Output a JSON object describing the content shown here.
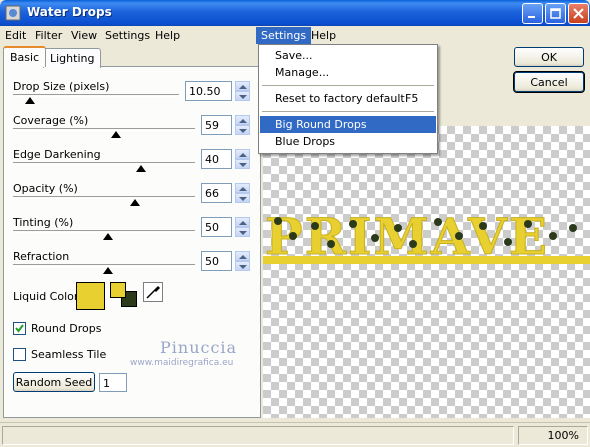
{
  "window": {
    "title": "Water Drops"
  },
  "menubar": {
    "items": [
      "Edit",
      "Filter",
      "View",
      "Settings",
      "Help",
      "Settings",
      "Help"
    ]
  },
  "tabs": [
    "Basic",
    "Lighting"
  ],
  "params": [
    {
      "label": "Drop Size (pixels)",
      "value": "10.50"
    },
    {
      "label": "Coverage (%)",
      "value": "59"
    },
    {
      "label": "Edge Darkening",
      "value": "40"
    },
    {
      "label": "Opacity (%)",
      "value": "66"
    },
    {
      "label": "Tinting (%)",
      "value": "50"
    },
    {
      "label": "Refraction",
      "value": "50"
    }
  ],
  "liquid_color": {
    "label": "Liquid Color",
    "color": "#e8d030",
    "fg": "#e8d030",
    "bg": "#2a3a1a"
  },
  "checkboxes": [
    {
      "label": "Round Drops",
      "checked": true
    },
    {
      "label": "Seamless Tile",
      "checked": false
    }
  ],
  "random_seed": {
    "button": "Random Seed",
    "value": "1"
  },
  "dialog_buttons": {
    "ok": "OK",
    "cancel": "Cancel"
  },
  "settings_menu": {
    "items": [
      {
        "label": "Save...",
        "shortcut": ""
      },
      {
        "label": "Manage...",
        "shortcut": ""
      },
      {
        "label": "Reset to factory default",
        "shortcut": "F5"
      },
      {
        "label": "Big Round Drops",
        "shortcut": ""
      },
      {
        "label": "Blue Drops",
        "shortcut": ""
      }
    ]
  },
  "preview": {
    "text": "PRIMAVE"
  },
  "status": {
    "zoom": "100%"
  },
  "watermark": {
    "line1": "Pinuccia",
    "line2": "www.maidiregrafica.eu"
  }
}
